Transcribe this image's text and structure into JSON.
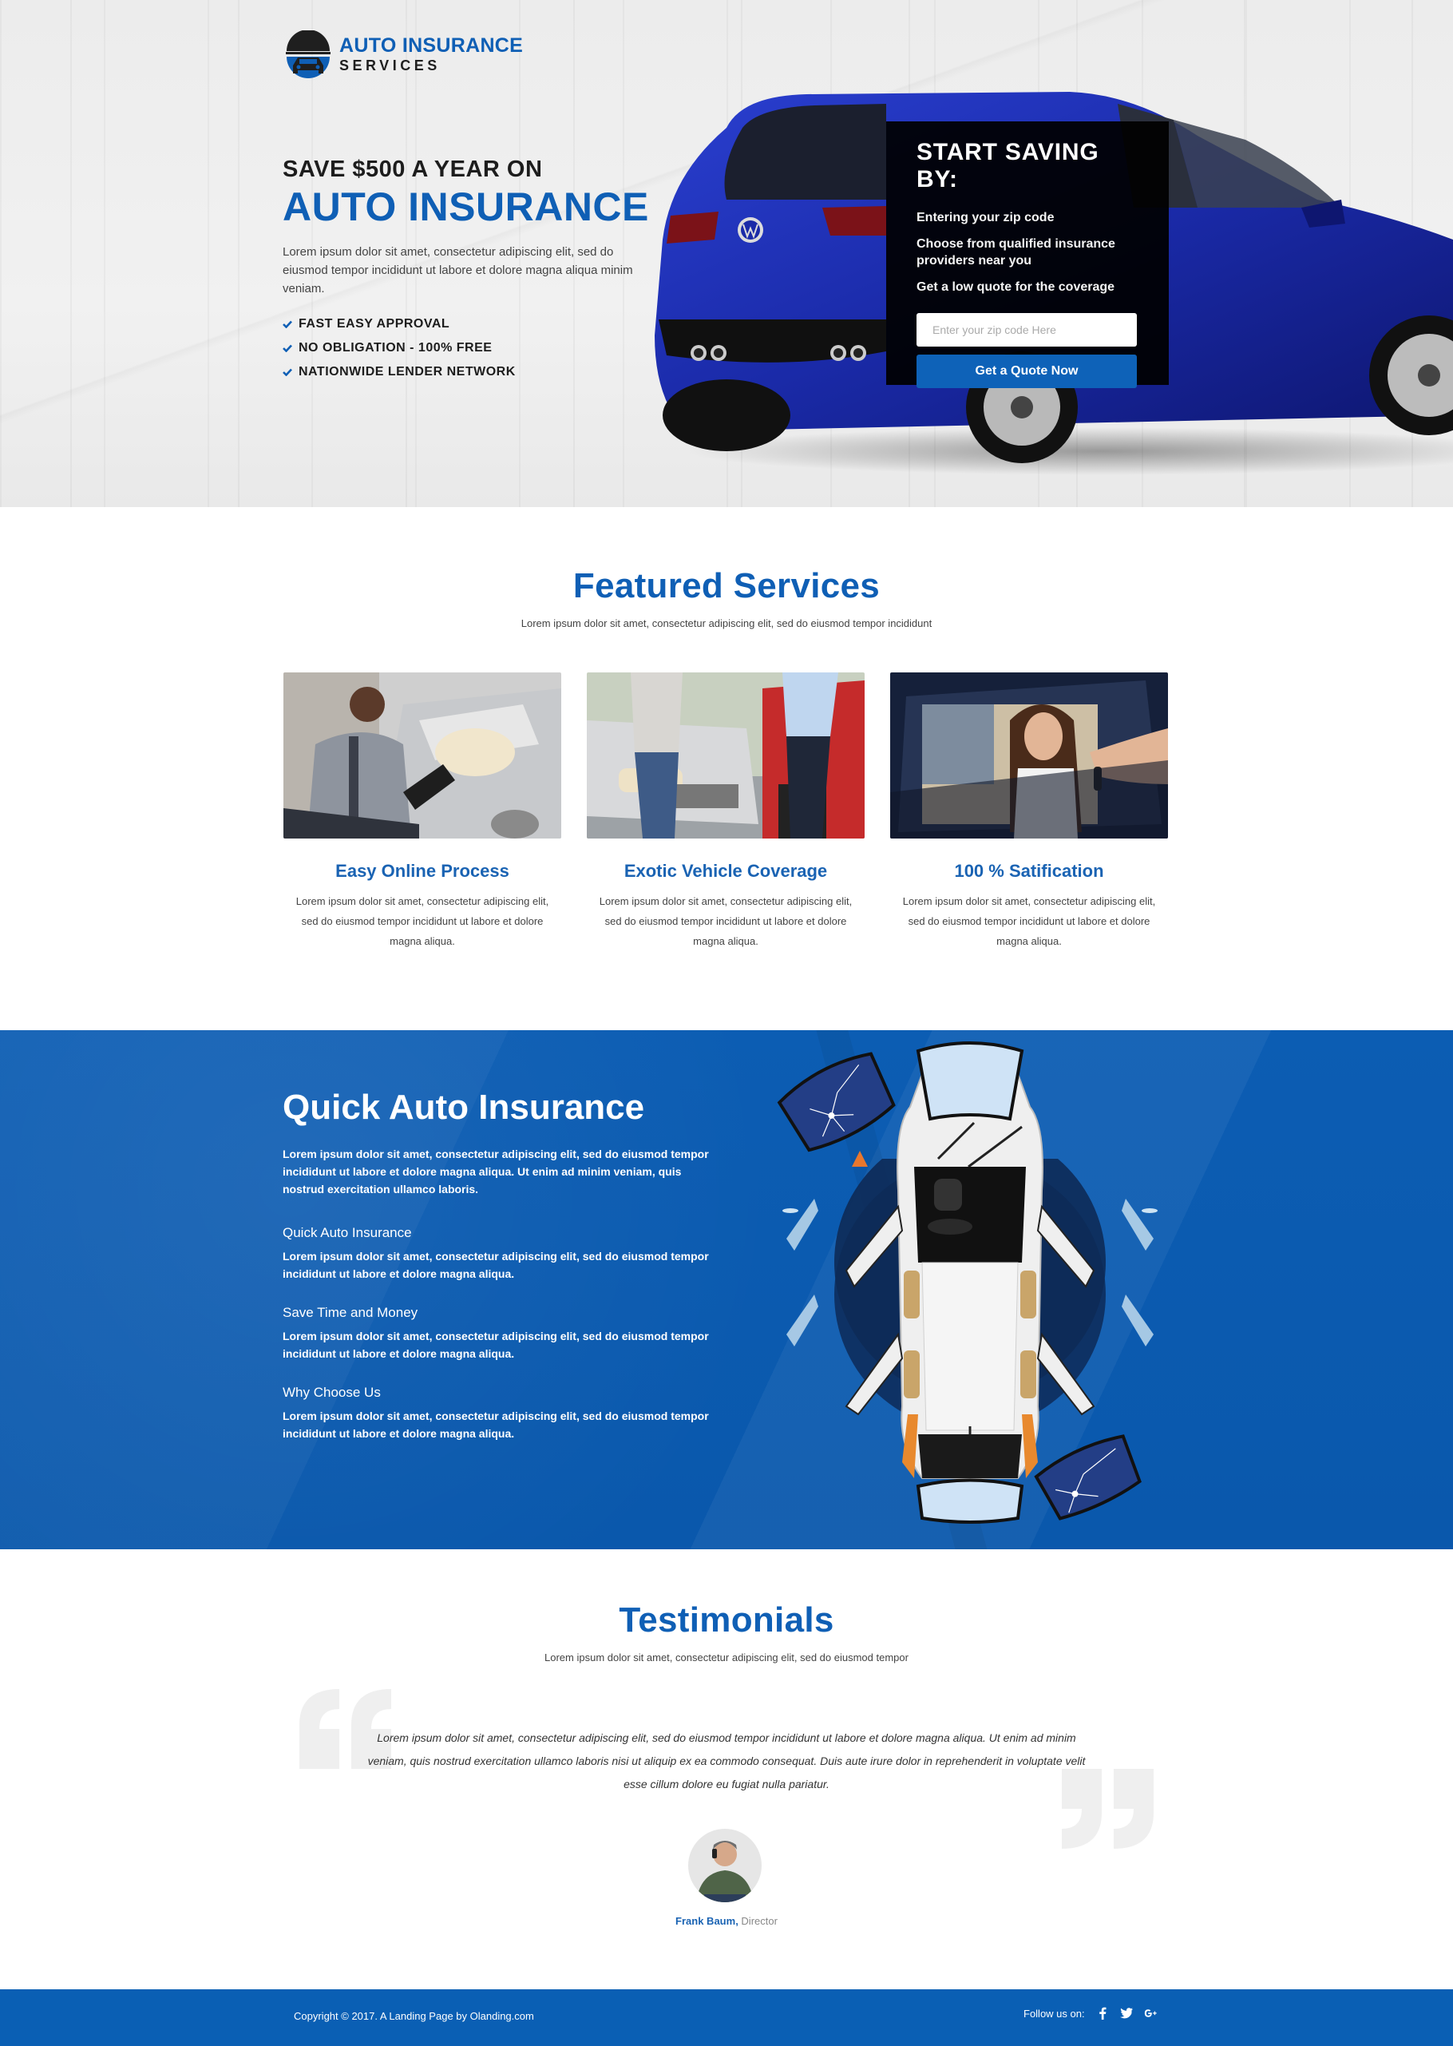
{
  "brand": {
    "line1": "AUTO INSURANCE",
    "line2": "SERVICES",
    "accent_color": "#0f5fb5"
  },
  "hero": {
    "kicker": "SAVE $500 A YEAR ON",
    "title": "AUTO INSURANCE",
    "description": "Lorem ipsum dolor sit amet, consectetur adipiscing elit, sed do eiusmod tempor incididunt ut labore et dolore magna aliqua minim veniam.",
    "features": [
      "FAST EASY APPROVAL",
      "NO OBLIGATION - 100% FREE",
      "NATIONWIDE LENDER NETWORK"
    ]
  },
  "quote_form": {
    "title": "START SAVING BY:",
    "steps": [
      "Entering your zip code",
      "Choose from qualified insurance providers near you",
      "Get a low quote for the coverage"
    ],
    "zip_placeholder": "Enter your zip code Here",
    "zip_value": "",
    "button_label": "Get a Quote Now"
  },
  "featured": {
    "title": "Featured Services",
    "subtitle": "Lorem ipsum dolor sit amet, consectetur adipiscing elit, sed do eiusmod tempor incididunt",
    "cards": [
      {
        "title": "Easy Online Process",
        "description": "Lorem ipsum dolor sit amet, consectetur adipiscing elit, sed do eiusmod tempor incididunt ut labore et dolore magna aliqua.",
        "image": "agent-inspecting-damaged-car-photo"
      },
      {
        "title": "Exotic Vehicle Coverage",
        "description": "Lorem ipsum dolor sit amet, consectetur adipiscing elit, sed do eiusmod tempor incididunt ut labore et dolore magna aliqua.",
        "image": "car-collision-drivers-photo"
      },
      {
        "title": "100 % Satification",
        "description": "Lorem ipsum dolor sit amet, consectetur adipiscing elit, sed do eiusmod tempor incididunt ut labore et dolore magna aliqua.",
        "image": "woman-receiving-car-keys-photo"
      }
    ]
  },
  "quick": {
    "title": "Quick Auto Insurance",
    "intro": "Lorem ipsum dolor sit amet, consectetur adipiscing elit, sed do eiusmod tempor incididunt ut labore et dolore magna aliqua. Ut enim ad minim veniam, quis nostrud exercitation ullamco laboris.",
    "items": [
      {
        "title": "Quick Auto Insurance",
        "text": "Lorem ipsum dolor sit amet, consectetur adipiscing elit, sed do eiusmod tempor incididunt ut labore et dolore magna aliqua."
      },
      {
        "title": "Save Time and Money",
        "text": "Lorem ipsum dolor sit amet, consectetur adipiscing elit, sed do eiusmod tempor incididunt ut labore et dolore magna aliqua."
      },
      {
        "title": "Why Choose Us",
        "text": "Lorem ipsum dolor sit amet, consectetur adipiscing elit, sed do eiusmod tempor incididunt ut labore et dolore magna aliqua."
      }
    ],
    "background_color": "#0c5db3"
  },
  "testimonials": {
    "title": "Testimonials",
    "subtitle": "Lorem ipsum dolor sit amet, consectetur adipiscing elit, sed do eiusmod tempor",
    "quote": "Lorem ipsum dolor sit amet, consectetur adipiscing elit, sed do eiusmod tempor incididunt ut labore et dolore magna aliqua. Ut enim ad minim veniam, quis nostrud exercitation ullamco laboris nisi ut aliquip ex ea commodo consequat. Duis aute irure dolor in reprehenderit in voluptate velit esse cillum dolore eu fugiat nulla pariatur.",
    "author_name": "Frank Baum",
    "author_sep": ", ",
    "author_role": "Director"
  },
  "footer": {
    "copyright": "Copyright © 2017. A Landing Page by  Olanding.com",
    "follow_label": "Follow us on:",
    "social": [
      {
        "name": "facebook-icon",
        "glyph": "f"
      },
      {
        "name": "twitter-icon",
        "glyph": "t"
      },
      {
        "name": "google-plus-icon",
        "glyph": "G+"
      }
    ],
    "background_color": "#0a5fb4"
  }
}
